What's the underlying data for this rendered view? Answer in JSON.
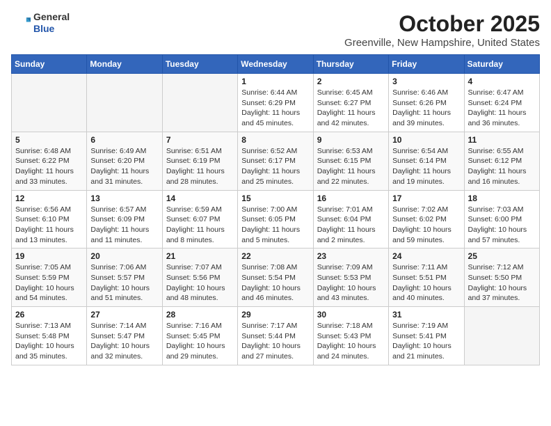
{
  "header": {
    "logo_general": "General",
    "logo_blue": "Blue",
    "month": "October 2025",
    "location": "Greenville, New Hampshire, United States"
  },
  "days_of_week": [
    "Sunday",
    "Monday",
    "Tuesday",
    "Wednesday",
    "Thursday",
    "Friday",
    "Saturday"
  ],
  "weeks": [
    {
      "days": [
        {
          "num": "",
          "info": ""
        },
        {
          "num": "",
          "info": ""
        },
        {
          "num": "",
          "info": ""
        },
        {
          "num": "1",
          "info": "Sunrise: 6:44 AM\nSunset: 6:29 PM\nDaylight: 11 hours and 45 minutes."
        },
        {
          "num": "2",
          "info": "Sunrise: 6:45 AM\nSunset: 6:27 PM\nDaylight: 11 hours and 42 minutes."
        },
        {
          "num": "3",
          "info": "Sunrise: 6:46 AM\nSunset: 6:26 PM\nDaylight: 11 hours and 39 minutes."
        },
        {
          "num": "4",
          "info": "Sunrise: 6:47 AM\nSunset: 6:24 PM\nDaylight: 11 hours and 36 minutes."
        }
      ]
    },
    {
      "days": [
        {
          "num": "5",
          "info": "Sunrise: 6:48 AM\nSunset: 6:22 PM\nDaylight: 11 hours and 33 minutes."
        },
        {
          "num": "6",
          "info": "Sunrise: 6:49 AM\nSunset: 6:20 PM\nDaylight: 11 hours and 31 minutes."
        },
        {
          "num": "7",
          "info": "Sunrise: 6:51 AM\nSunset: 6:19 PM\nDaylight: 11 hours and 28 minutes."
        },
        {
          "num": "8",
          "info": "Sunrise: 6:52 AM\nSunset: 6:17 PM\nDaylight: 11 hours and 25 minutes."
        },
        {
          "num": "9",
          "info": "Sunrise: 6:53 AM\nSunset: 6:15 PM\nDaylight: 11 hours and 22 minutes."
        },
        {
          "num": "10",
          "info": "Sunrise: 6:54 AM\nSunset: 6:14 PM\nDaylight: 11 hours and 19 minutes."
        },
        {
          "num": "11",
          "info": "Sunrise: 6:55 AM\nSunset: 6:12 PM\nDaylight: 11 hours and 16 minutes."
        }
      ]
    },
    {
      "days": [
        {
          "num": "12",
          "info": "Sunrise: 6:56 AM\nSunset: 6:10 PM\nDaylight: 11 hours and 13 minutes."
        },
        {
          "num": "13",
          "info": "Sunrise: 6:57 AM\nSunset: 6:09 PM\nDaylight: 11 hours and 11 minutes."
        },
        {
          "num": "14",
          "info": "Sunrise: 6:59 AM\nSunset: 6:07 PM\nDaylight: 11 hours and 8 minutes."
        },
        {
          "num": "15",
          "info": "Sunrise: 7:00 AM\nSunset: 6:05 PM\nDaylight: 11 hours and 5 minutes."
        },
        {
          "num": "16",
          "info": "Sunrise: 7:01 AM\nSunset: 6:04 PM\nDaylight: 11 hours and 2 minutes."
        },
        {
          "num": "17",
          "info": "Sunrise: 7:02 AM\nSunset: 6:02 PM\nDaylight: 10 hours and 59 minutes."
        },
        {
          "num": "18",
          "info": "Sunrise: 7:03 AM\nSunset: 6:00 PM\nDaylight: 10 hours and 57 minutes."
        }
      ]
    },
    {
      "days": [
        {
          "num": "19",
          "info": "Sunrise: 7:05 AM\nSunset: 5:59 PM\nDaylight: 10 hours and 54 minutes."
        },
        {
          "num": "20",
          "info": "Sunrise: 7:06 AM\nSunset: 5:57 PM\nDaylight: 10 hours and 51 minutes."
        },
        {
          "num": "21",
          "info": "Sunrise: 7:07 AM\nSunset: 5:56 PM\nDaylight: 10 hours and 48 minutes."
        },
        {
          "num": "22",
          "info": "Sunrise: 7:08 AM\nSunset: 5:54 PM\nDaylight: 10 hours and 46 minutes."
        },
        {
          "num": "23",
          "info": "Sunrise: 7:09 AM\nSunset: 5:53 PM\nDaylight: 10 hours and 43 minutes."
        },
        {
          "num": "24",
          "info": "Sunrise: 7:11 AM\nSunset: 5:51 PM\nDaylight: 10 hours and 40 minutes."
        },
        {
          "num": "25",
          "info": "Sunrise: 7:12 AM\nSunset: 5:50 PM\nDaylight: 10 hours and 37 minutes."
        }
      ]
    },
    {
      "days": [
        {
          "num": "26",
          "info": "Sunrise: 7:13 AM\nSunset: 5:48 PM\nDaylight: 10 hours and 35 minutes."
        },
        {
          "num": "27",
          "info": "Sunrise: 7:14 AM\nSunset: 5:47 PM\nDaylight: 10 hours and 32 minutes."
        },
        {
          "num": "28",
          "info": "Sunrise: 7:16 AM\nSunset: 5:45 PM\nDaylight: 10 hours and 29 minutes."
        },
        {
          "num": "29",
          "info": "Sunrise: 7:17 AM\nSunset: 5:44 PM\nDaylight: 10 hours and 27 minutes."
        },
        {
          "num": "30",
          "info": "Sunrise: 7:18 AM\nSunset: 5:43 PM\nDaylight: 10 hours and 24 minutes."
        },
        {
          "num": "31",
          "info": "Sunrise: 7:19 AM\nSunset: 5:41 PM\nDaylight: 10 hours and 21 minutes."
        },
        {
          "num": "",
          "info": ""
        }
      ]
    }
  ]
}
